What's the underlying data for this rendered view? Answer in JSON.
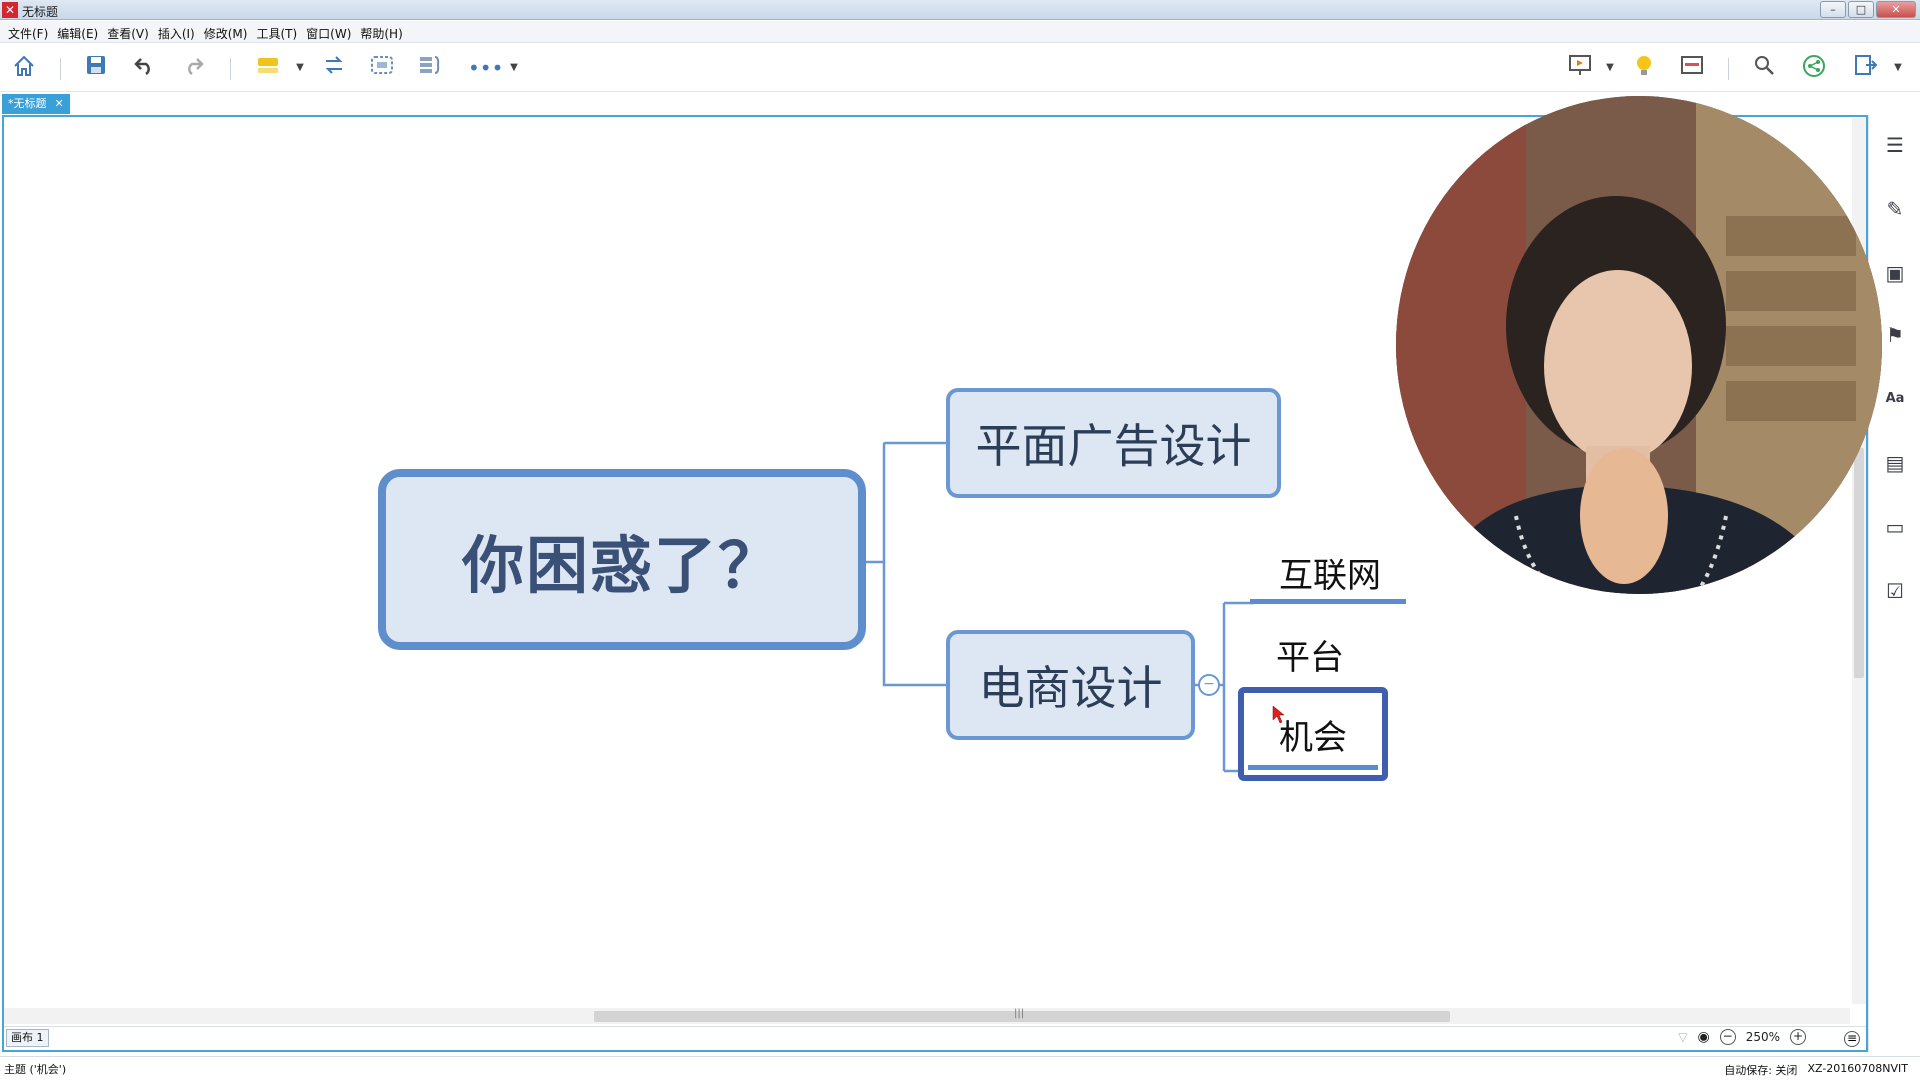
{
  "window": {
    "title": "无标题",
    "app_logo": "✕"
  },
  "menu": [
    {
      "label": "文件(F)"
    },
    {
      "label": "编辑(E)"
    },
    {
      "label": "查看(V)"
    },
    {
      "label": "插入(I)"
    },
    {
      "label": "修改(M)"
    },
    {
      "label": "工具(T)"
    },
    {
      "label": "窗口(W)"
    },
    {
      "label": "帮助(H)"
    }
  ],
  "toolbar": {
    "icons": [
      "home-icon",
      "save-icon",
      "undo-icon",
      "redo-icon",
      "topic-icon",
      "swap-icon",
      "boundary-icon",
      "summary-icon",
      "more-icon"
    ],
    "right_icons": [
      "presentation-icon",
      "lightbulb-icon",
      "layout-icon",
      "search-icon",
      "share-icon",
      "export-icon"
    ]
  },
  "tab": {
    "label": "*无标题",
    "close": "✕"
  },
  "mindmap": {
    "central": "你困惑了？",
    "branch1": "平面广告设计",
    "branch2": "电商设计",
    "sub1": "互联网",
    "sub2": "平台",
    "sub3": "机会",
    "collapse": "−"
  },
  "right_panel_icons": [
    "outline-icon",
    "format-icon",
    "image-icon",
    "flag-icon",
    "text-style-icon",
    "notes-icon",
    "comment-icon",
    "task-icon"
  ],
  "canvas_footer": {
    "sheet": "画布 1",
    "zoom": "250%",
    "zoom_minus": "−",
    "zoom_plus": "+"
  },
  "status": {
    "topic": "主题 ('机会')",
    "autosave": "自动保存: 关闭",
    "user": "XZ-20160708NVIT"
  },
  "colors": {
    "accent": "#46a6d8",
    "node_border": "#6b98d3",
    "node_fill": "#dde7f3",
    "selected": "#3f5fae"
  }
}
